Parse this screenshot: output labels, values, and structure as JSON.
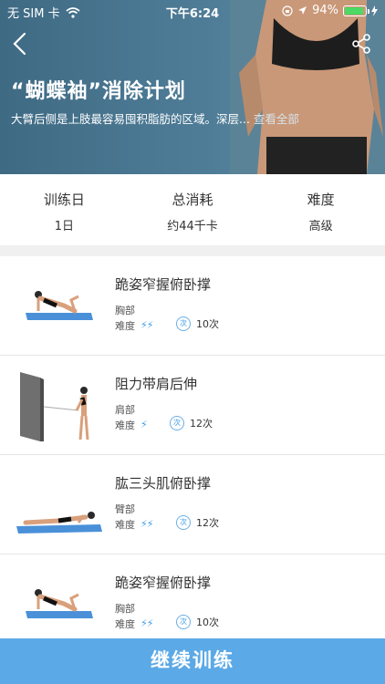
{
  "status_bar": {
    "carrier": "无 SIM 卡",
    "time": "下午6:24",
    "battery": "94%"
  },
  "header": {
    "title": "“蝴蝶袖”消除计划",
    "description": "大臂后侧是上肢最容易囤积脂肪的区域。深层...",
    "more_label": "查看全部"
  },
  "stats": [
    {
      "label": "训练日",
      "value": "1日"
    },
    {
      "label": "总消耗",
      "value": "约44千卡"
    },
    {
      "label": "难度",
      "value": "高级"
    }
  ],
  "exercises": [
    {
      "name": "跪姿窄握俯卧撑",
      "body_part": "胸部",
      "difficulty_label": "难度",
      "difficulty": "⚡⚡",
      "badge": "次",
      "count": "10次"
    },
    {
      "name": "阻力带肩后伸",
      "body_part": "肩部",
      "difficulty_label": "难度",
      "difficulty": "⚡",
      "badge": "次",
      "count": "12次"
    },
    {
      "name": "肱三头肌俯卧撑",
      "body_part": "臂部",
      "difficulty_label": "难度",
      "difficulty": "⚡⚡",
      "badge": "次",
      "count": "12次"
    },
    {
      "name": "跪姿窄握俯卧撑",
      "body_part": "胸部",
      "difficulty_label": "难度",
      "difficulty": "⚡⚡",
      "badge": "次",
      "count": "10次"
    }
  ],
  "cta": {
    "label": "继续训练"
  },
  "colors": {
    "accent": "#5ba9e6",
    "hero": "#4f7d97",
    "bolt": "#3f9de8"
  }
}
